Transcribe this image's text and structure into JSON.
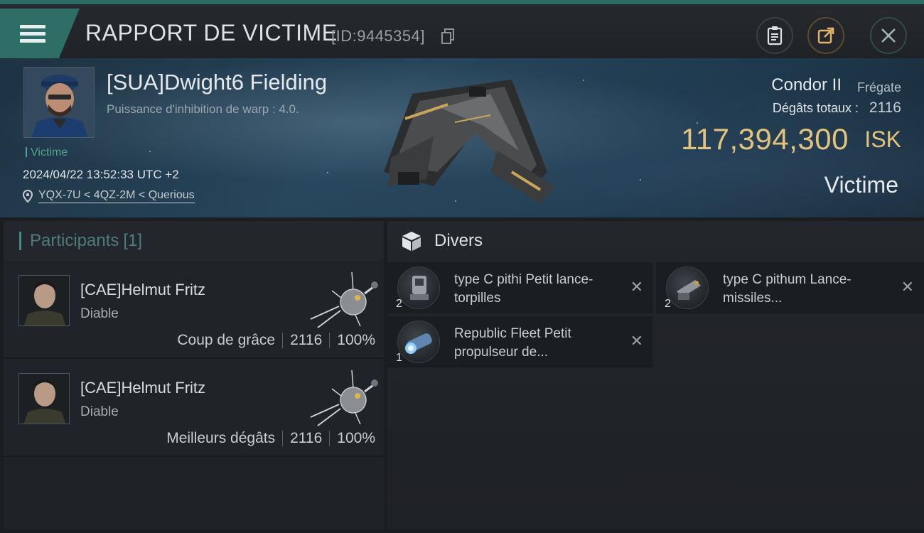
{
  "header": {
    "title": "RAPPORT DE VICTIME",
    "report_id": "[ID:9445354]"
  },
  "victim": {
    "name": "[SUA]Dwight6 Fielding",
    "subtitle": "Puissance d'inhibition de warp : 4.0.",
    "tag": "Victime",
    "datetime": "2024/04/22 13:52:33 UTC +2",
    "location": "YQX-7U < 4QZ-2M < Querious",
    "ship_name": "Condor II",
    "ship_class": "Frégate",
    "damage_label": "Dégâts totaux :",
    "damage_value": "2116",
    "isk_value": "117,394,300",
    "isk_unit": "ISK",
    "role": "Victime"
  },
  "participants": {
    "label": "Participants",
    "count": "[1]",
    "rows": [
      {
        "name": "[CAE]Helmut Fritz",
        "ship": "Diable",
        "role": "Coup de grâce",
        "damage": "2116",
        "percent": "100%"
      },
      {
        "name": "[CAE]Helmut Fritz",
        "ship": "Diable",
        "role": "Meilleurs dégâts",
        "damage": "2116",
        "percent": "100%"
      }
    ]
  },
  "divers": {
    "label": "Divers",
    "items": [
      {
        "name": "type C pithi Petit lance-torpilles",
        "qty": "2"
      },
      {
        "name": "type C pithum Lance-missiles...",
        "qty": "2"
      },
      {
        "name": "Republic Fleet Petit propulseur de...",
        "qty": "1"
      }
    ]
  },
  "icons": {
    "menu": "hamburger-icon",
    "copy": "copy-icon",
    "clipboard": "clipboard-icon",
    "share": "share-icon",
    "close": "close-icon",
    "location": "location-pin-icon",
    "divers": "cube-icon",
    "remove": "x-icon"
  },
  "colors": {
    "accent": "#2f6e66",
    "isk": "#e2c27c",
    "victim_tag": "#4fa58f"
  }
}
